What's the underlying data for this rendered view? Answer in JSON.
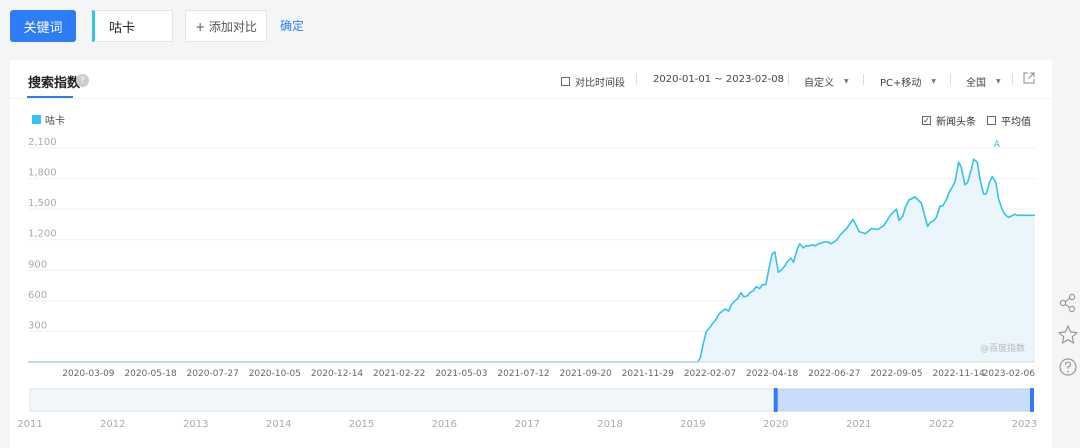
{
  "search": {
    "keyword_button": "关键词",
    "keyword_value": "咕卡",
    "add_compare": "+ 添加对比",
    "confirm": "确定"
  },
  "panel": {
    "title": "搜索指数",
    "compare_period": "对比时间段",
    "date_range": "2020-01-01 ~ 2023-02-08",
    "custom": "自定义",
    "device": "PC+移动",
    "region": "全国",
    "news_toggle": "新闻头条",
    "average_toggle": "平均值",
    "news_checked": true,
    "average_checked": false,
    "watermark": "@百度指数"
  },
  "colors": {
    "primary": "#2f7df6",
    "series": "#35c2ec"
  },
  "icons": [
    "help-icon",
    "external-link-icon",
    "share-icon",
    "star-icon",
    "question-icon"
  ],
  "chart_data": {
    "type": "area",
    "series": [
      {
        "name": "咕卡",
        "x": [
          "2020-01-01",
          "2020-03-09",
          "2020-05-18",
          "2020-07-27",
          "2020-10-05",
          "2020-12-14",
          "2021-02-22",
          "2021-05-03",
          "2021-07-12",
          "2021-09-20",
          "2021-11-29",
          "2022-01-20",
          "2022-01-24",
          "2022-01-27",
          "2022-01-31",
          "2022-02-03",
          "2022-02-07",
          "2022-02-10",
          "2022-02-14",
          "2022-02-17",
          "2022-02-21",
          "2022-02-24",
          "2022-02-28",
          "2022-03-03",
          "2022-03-07",
          "2022-03-10",
          "2022-03-14",
          "2022-03-17",
          "2022-03-21",
          "2022-03-24",
          "2022-03-28",
          "2022-03-31",
          "2022-04-04",
          "2022-04-07",
          "2022-04-11",
          "2022-04-14",
          "2022-04-18",
          "2022-04-21",
          "2022-04-25",
          "2022-04-28",
          "2022-05-02",
          "2022-05-05",
          "2022-05-09",
          "2022-05-12",
          "2022-05-16",
          "2022-05-19",
          "2022-05-23",
          "2022-05-26",
          "2022-05-30",
          "2022-06-02",
          "2022-06-06",
          "2022-06-09",
          "2022-06-13",
          "2022-06-16",
          "2022-06-20",
          "2022-06-23",
          "2022-06-27",
          "2022-06-30",
          "2022-07-04",
          "2022-07-11",
          "2022-07-18",
          "2022-07-25",
          "2022-08-01",
          "2022-08-08",
          "2022-08-15",
          "2022-08-22",
          "2022-08-29",
          "2022-09-05",
          "2022-09-08",
          "2022-09-12",
          "2022-09-15",
          "2022-09-19",
          "2022-09-26",
          "2022-10-03",
          "2022-10-10",
          "2022-10-13",
          "2022-10-17",
          "2022-10-20",
          "2022-10-24",
          "2022-10-27",
          "2022-10-31",
          "2022-11-03",
          "2022-11-07",
          "2022-11-10",
          "2022-11-14",
          "2022-11-17",
          "2022-11-21",
          "2022-11-24",
          "2022-11-28",
          "2022-12-01",
          "2022-12-05",
          "2022-12-08",
          "2022-12-12",
          "2022-12-15",
          "2022-12-19",
          "2022-12-22",
          "2022-12-26",
          "2022-12-29",
          "2023-01-02",
          "2023-01-05",
          "2023-01-09",
          "2023-01-12",
          "2023-01-16",
          "2023-01-19",
          "2023-01-23",
          "2023-01-26",
          "2023-01-30",
          "2023-02-02",
          "2023-02-06",
          "2023-02-08"
        ],
        "values": [
          0,
          0,
          0,
          0,
          0,
          0,
          0,
          0,
          0,
          0,
          0,
          0,
          0,
          40,
          200,
          300,
          340,
          380,
          420,
          470,
          500,
          520,
          500,
          560,
          600,
          620,
          680,
          640,
          650,
          680,
          700,
          740,
          720,
          760,
          760,
          900,
          1060,
          1080,
          880,
          900,
          940,
          980,
          1020,
          980,
          1100,
          1160,
          1120,
          1140,
          1140,
          1150,
          1140,
          1160,
          1170,
          1180,
          1180,
          1160,
          1180,
          1200,
          1250,
          1310,
          1400,
          1280,
          1260,
          1310,
          1300,
          1340,
          1440,
          1500,
          1390,
          1430,
          1520,
          1590,
          1620,
          1560,
          1330,
          1370,
          1390,
          1420,
          1530,
          1530,
          1590,
          1660,
          1720,
          1770,
          1960,
          1910,
          1740,
          1760,
          1880,
          1990,
          1960,
          1800,
          1650,
          1650,
          1770,
          1820,
          1760,
          1600,
          1500,
          1450,
          1420,
          1430,
          1450,
          1440,
          1440,
          1440,
          1440,
          1440,
          1440,
          1440
        ],
        "values_note": null
      }
    ],
    "x_tick_labels": [
      "2020-03-09",
      "2020-05-18",
      "2020-07-27",
      "2020-10-05",
      "2020-12-14",
      "2021-02-22",
      "2021-05-03",
      "2021-07-12",
      "2021-09-20",
      "2021-11-29",
      "2022-02-07",
      "2022-04-18",
      "2022-06-27",
      "2022-09-05",
      "2022-11-14",
      "2023-02-06"
    ],
    "y_tick_labels": [
      "300",
      "600",
      "900",
      "1,200",
      "1,500",
      "1,800",
      "2,100"
    ],
    "ylim": [
      0,
      2100
    ],
    "peak_marker": "A",
    "navigator_years": [
      "2011",
      "2012",
      "2013",
      "2014",
      "2015",
      "2016",
      "2017",
      "2018",
      "2019",
      "2020",
      "2021",
      "2022",
      "2023"
    ],
    "grid": true,
    "legend": "top-left"
  }
}
